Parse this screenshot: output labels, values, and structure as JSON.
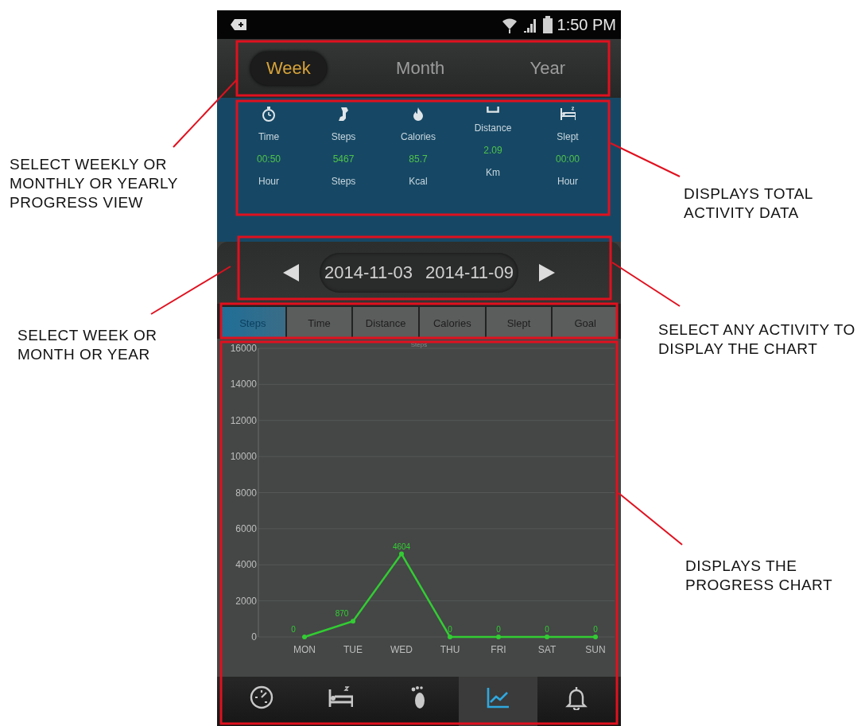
{
  "status_bar": {
    "time": "1:50 PM"
  },
  "period_tabs": [
    {
      "label": "Week",
      "selected": true
    },
    {
      "label": "Month",
      "selected": false
    },
    {
      "label": "Year",
      "selected": false
    }
  ],
  "totals": [
    {
      "label": "Time",
      "value": "00:50",
      "unit": "Hour"
    },
    {
      "label": "Steps",
      "value": "5467",
      "unit": "Steps"
    },
    {
      "label": "Calories",
      "value": "85.7",
      "unit": "Kcal"
    },
    {
      "label": "Distance",
      "value": "2.09",
      "unit": "Km"
    },
    {
      "label": "Slept",
      "value": "00:00",
      "unit": "Hour"
    }
  ],
  "date_range": {
    "start": "2014-11-03",
    "end": "2014-11-09"
  },
  "activity_tabs": [
    {
      "label": "Steps",
      "selected": true
    },
    {
      "label": "Time",
      "selected": false
    },
    {
      "label": "Distance",
      "selected": false
    },
    {
      "label": "Calories",
      "selected": false
    },
    {
      "label": "Slept",
      "selected": false
    },
    {
      "label": "Goal",
      "selected": false
    }
  ],
  "chart": {
    "chart_data": {
      "type": "line",
      "grid": true,
      "categories": [
        "MON",
        "TUE",
        "WED",
        "THU",
        "FRI",
        "SAT",
        "SUN"
      ],
      "series": [
        {
          "name": "Steps",
          "color": "#33cc33",
          "marker": true,
          "values": [
            0,
            870,
            4604,
            0,
            0,
            0,
            0
          ]
        }
      ],
      "ylim": [
        0,
        16000
      ],
      "yticks": [
        0,
        2000,
        4000,
        6000,
        8000,
        10000,
        12000,
        14000,
        16000
      ],
      "data_labels": true
    }
  },
  "bottom_nav": [
    {
      "selected": false
    },
    {
      "selected": false
    },
    {
      "selected": false
    },
    {
      "selected": true
    },
    {
      "selected": false
    }
  ],
  "annotations": [
    {
      "text": "SELECT WEEKLY OR MONTHLY OR YEARLY PROGRESS VIEW"
    },
    {
      "text": "SELECT WEEK OR MONTH OR YEAR"
    },
    {
      "text": "DISPLAYS TOTAL ACTIVITY DATA"
    },
    {
      "text": "SELECT ANY ACTIVITY TO DISPLAY THE CHART"
    },
    {
      "text": "DISPLAYS THE PROGRESS CHART"
    }
  ]
}
